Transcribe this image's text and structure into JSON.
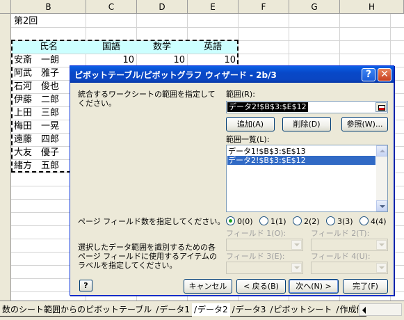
{
  "sheet": {
    "columns": [
      "B",
      "C",
      "D",
      "E",
      "F",
      "G",
      "H"
    ],
    "title": "第2回",
    "headers": [
      "氏名",
      "国語",
      "数学",
      "英語"
    ],
    "rows": [
      {
        "name": "安斎　一朗",
        "v1": "10",
        "v2": "10",
        "v3": "10"
      },
      {
        "name": "阿武　雅子"
      },
      {
        "name": "石河　俊也"
      },
      {
        "name": "伊藤　二郎"
      },
      {
        "name": "上田　三郎"
      },
      {
        "name": "梅田　一晃"
      },
      {
        "name": "遠藤　四郎"
      },
      {
        "name": "大友　優子"
      },
      {
        "name": "緒方　五郎"
      }
    ],
    "colors": {
      "header_fill": "#ccffff",
      "grid": "#d4d4d4"
    }
  },
  "dialog": {
    "title": "ピボットテーブル/ピボットグラフ ウィザード - 2b/3",
    "help_icon": "question-icon",
    "close_icon": "close-icon",
    "instruction": "統合するワークシートの範囲を指定してください。",
    "range_label": "範囲(R):",
    "range_value": "データ2!$B$3:$E$12",
    "btn_add": "追加(A)",
    "btn_delete": "削除(D)",
    "btn_browse": "参照(W)...",
    "list_label": "範囲一覧(L):",
    "list_items": [
      "データ1!$B$3:$E$13",
      "データ2!$B$3:$E$12"
    ],
    "selected_index": 1,
    "page_field_label": "ページ フィールド数を指定してください。",
    "radio_options": [
      "0(0)",
      "1(1)",
      "2(2)",
      "3(3)",
      "4(4)"
    ],
    "radio_selected": 0,
    "field1": "フィールド 1(O):",
    "field2": "フィールド 2(T):",
    "field3": "フィールド 3(E):",
    "field4": "フィールド 4(U):",
    "item_label": "選択したデータ範囲を識別するための各ページ フィールドに使用するアイテムのラベルを指定してください。",
    "btn_help": "?",
    "btn_cancel": "キャンセル",
    "btn_back": "< 戻る(B)",
    "btn_next": "次へ(N) >",
    "btn_finish": "完了(F)"
  },
  "tabs": {
    "items": [
      "数のシート範囲からのピボットテーブル",
      "データ1",
      "データ2",
      "データ3",
      "ピボットシート",
      "作成例"
    ],
    "active_index": 2
  }
}
